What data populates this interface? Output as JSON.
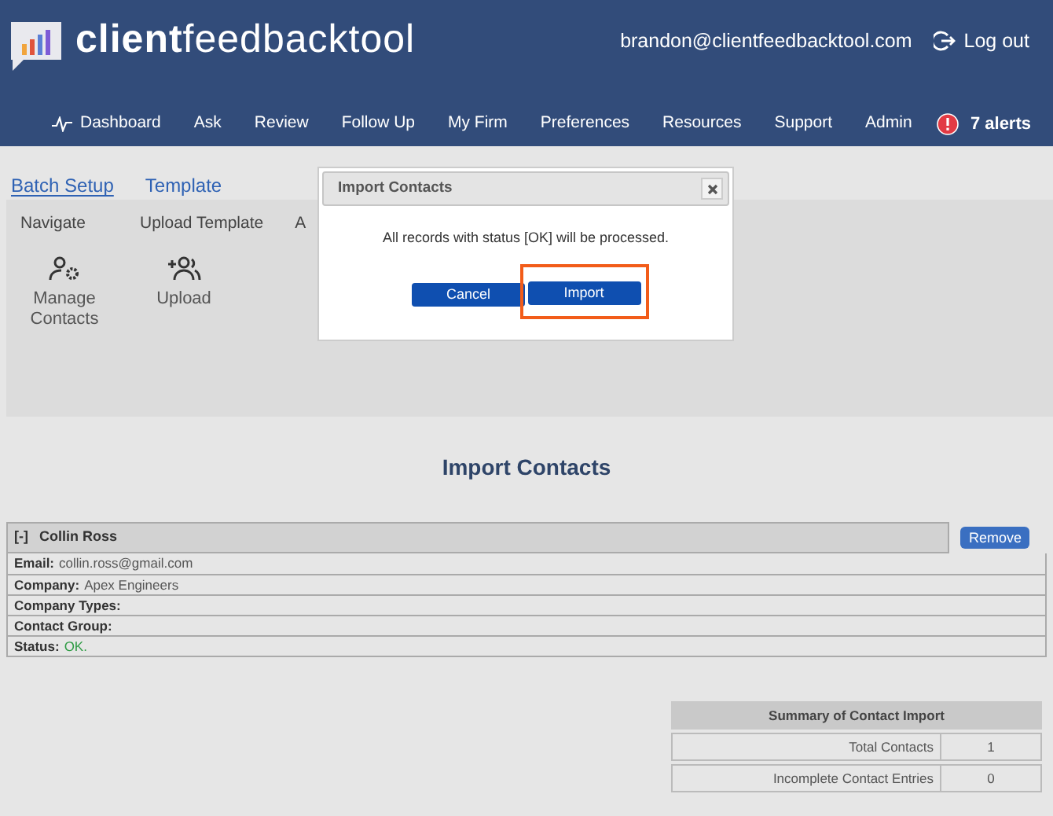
{
  "header": {
    "logo_bold": "client",
    "logo_light": "feedbacktool",
    "user_email": "brandon@clientfeedbacktool.com",
    "logout": "Log out"
  },
  "nav": {
    "items": [
      {
        "label": "Dashboard",
        "kind": "pulse"
      },
      {
        "label": "Ask",
        "kind": "plain"
      },
      {
        "label": "Review",
        "kind": "plain"
      },
      {
        "label": "Follow Up",
        "kind": "plain"
      },
      {
        "label": "My Firm",
        "kind": "plain"
      },
      {
        "label": "Preferences",
        "kind": "plain"
      },
      {
        "label": "Resources",
        "kind": "plain"
      },
      {
        "label": "Support",
        "kind": "plain"
      },
      {
        "label": "Admin",
        "kind": "plain"
      }
    ],
    "alerts": "7 alerts"
  },
  "tabs": [
    {
      "label": "Batch Setup",
      "selected": true
    },
    {
      "label": "Template",
      "selected": false
    }
  ],
  "toolbar": {
    "groups": [
      {
        "heading": "Navigate",
        "actions": [
          {
            "label": "Manage Contacts",
            "kind": "manage"
          }
        ]
      },
      {
        "heading": "Upload Template",
        "actions": [
          {
            "label": "Upload",
            "kind": "upload"
          }
        ]
      },
      {
        "heading": "A"
      }
    ]
  },
  "dialog": {
    "title": "Import Contacts",
    "message": "All records with status [OK] will be processed.",
    "buttons": [
      {
        "label": "Cancel",
        "highlighted": false
      },
      {
        "label": "Import",
        "highlighted": true
      }
    ]
  },
  "page_title": "Import Contacts",
  "contact": {
    "toggle": "[-]",
    "name": "Collin Ross",
    "remove": "Remove",
    "fields": [
      {
        "label": "Email:",
        "value": "collin.ross@gmail.com",
        "kind": "text"
      },
      {
        "label": "Company:",
        "value": "Apex Engineers",
        "kind": "text"
      },
      {
        "label": "Company Types:",
        "kind": "text"
      },
      {
        "label": "Contact Group:",
        "kind": "text"
      },
      {
        "label": "Status:",
        "value": "OK.",
        "kind": "status"
      }
    ]
  },
  "summary": {
    "title": "Summary of Contact Import",
    "rows": [
      {
        "label": "Total Contacts",
        "value": "1"
      },
      {
        "label": "Incomplete Contact Entries",
        "value": "0"
      }
    ]
  }
}
